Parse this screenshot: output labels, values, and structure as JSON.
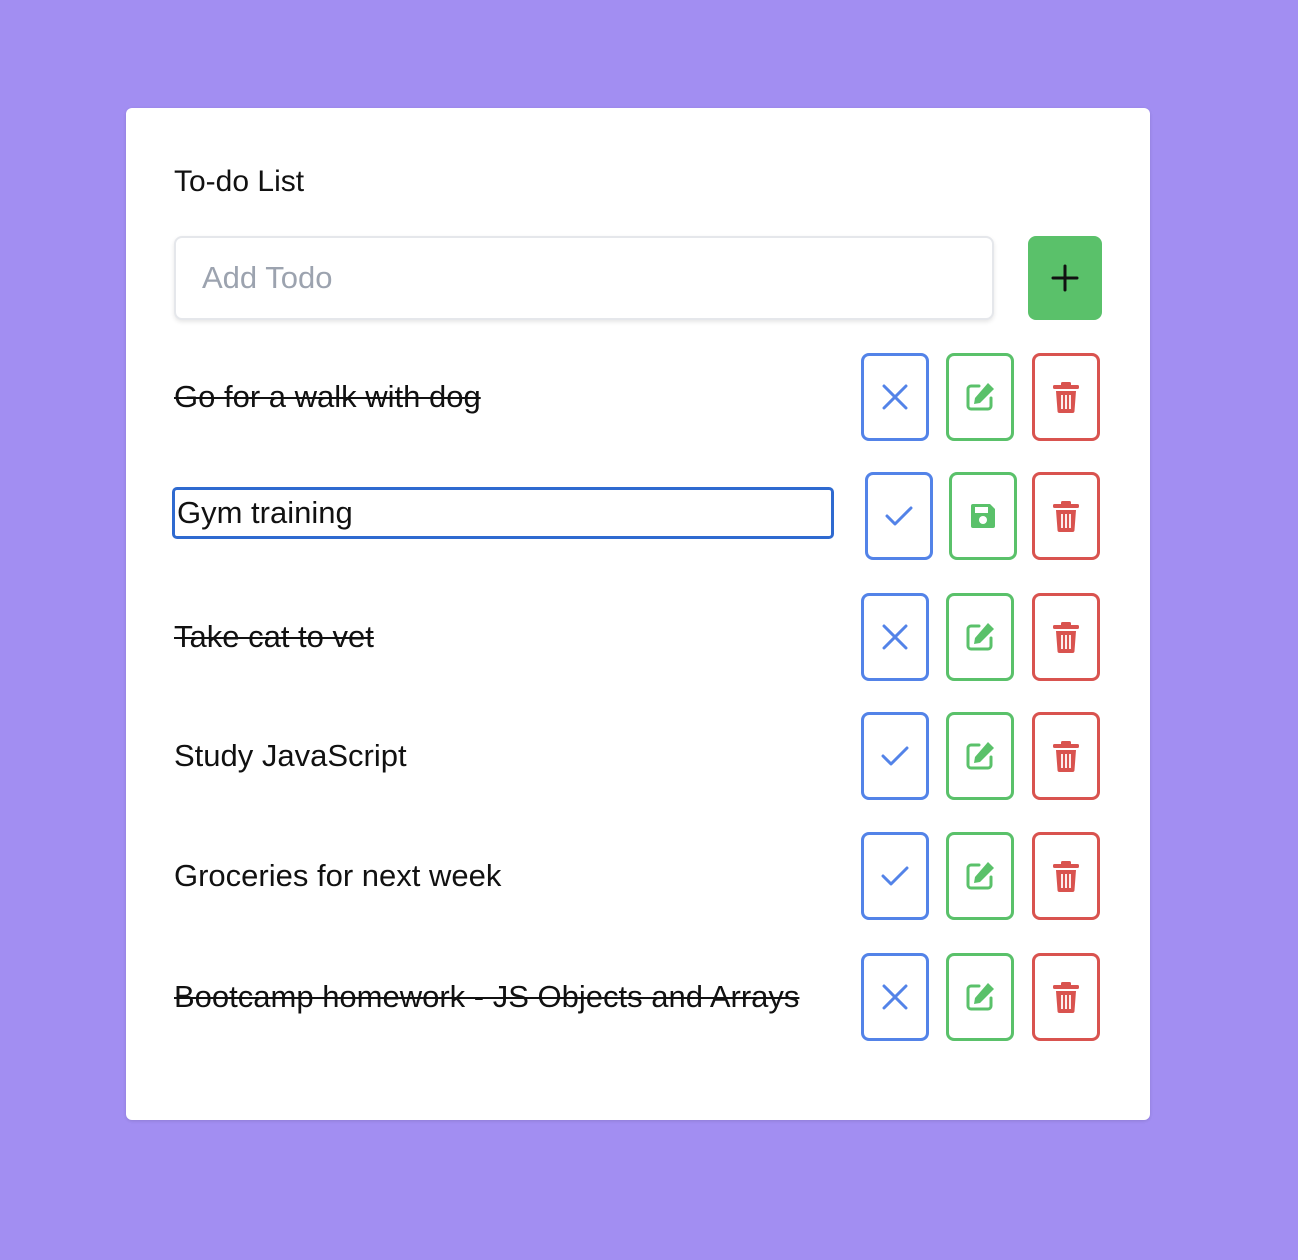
{
  "title": "To-do List",
  "add_todo": {
    "placeholder": "Add Todo",
    "button_icon": "plus-icon"
  },
  "colors": {
    "background": "#a28ef2",
    "toggle": "#5383e8",
    "edit": "#5ac16a",
    "delete": "#d9534f",
    "edit_focus": "#2f6ad0"
  },
  "todos": [
    {
      "text": "Go for a walk with dog",
      "completed": true,
      "editing": false,
      "toggle_icon": "x-icon",
      "edit_icon": "pencil-square-icon",
      "delete_icon": "trash-icon"
    },
    {
      "text": "Gym training",
      "completed": false,
      "editing": true,
      "toggle_icon": "check-icon",
      "edit_icon": "floppy-disk-icon",
      "delete_icon": "trash-icon"
    },
    {
      "text": "Take cat to vet",
      "completed": true,
      "editing": false,
      "toggle_icon": "x-icon",
      "edit_icon": "pencil-square-icon",
      "delete_icon": "trash-icon"
    },
    {
      "text": "Study JavaScript",
      "completed": false,
      "editing": false,
      "toggle_icon": "check-icon",
      "edit_icon": "pencil-square-icon",
      "delete_icon": "trash-icon"
    },
    {
      "text": "Groceries for next week",
      "completed": false,
      "editing": false,
      "toggle_icon": "check-icon",
      "edit_icon": "pencil-square-icon",
      "delete_icon": "trash-icon"
    },
    {
      "text": "Bootcamp homework - JS Objects and Arrays",
      "completed": true,
      "editing": false,
      "toggle_icon": "x-icon",
      "edit_icon": "pencil-square-icon",
      "delete_icon": "trash-icon"
    }
  ]
}
